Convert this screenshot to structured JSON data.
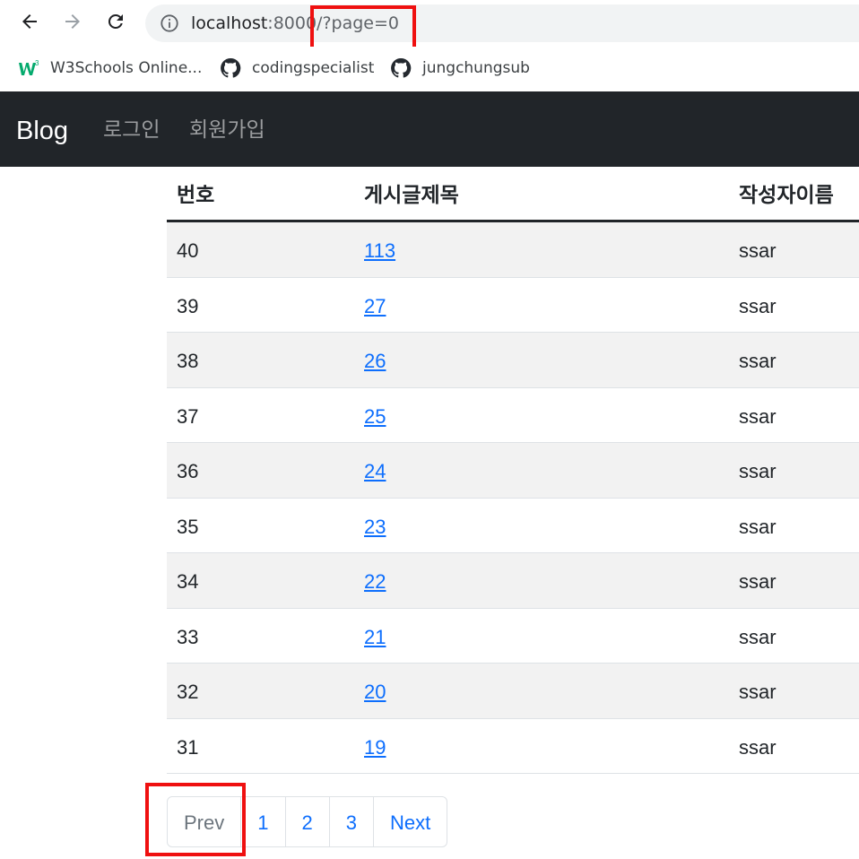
{
  "browser": {
    "url_host": "localhost",
    "url_rest": ":8000/?page=0",
    "bookmarks": [
      {
        "label": "W3Schools Online...",
        "icon": "w3schools-icon"
      },
      {
        "label": "codingspecialist",
        "icon": "github-icon"
      },
      {
        "label": "jungchungsub",
        "icon": "github-icon"
      }
    ]
  },
  "navbar": {
    "brand": "Blog",
    "links": [
      "로그인",
      "회원가입"
    ]
  },
  "table": {
    "headers": [
      "번호",
      "게시글제목",
      "작성자이름"
    ],
    "rows": [
      {
        "id": "40",
        "title": "113",
        "author": "ssar"
      },
      {
        "id": "39",
        "title": "27",
        "author": "ssar"
      },
      {
        "id": "38",
        "title": "26",
        "author": "ssar"
      },
      {
        "id": "37",
        "title": "25",
        "author": "ssar"
      },
      {
        "id": "36",
        "title": "24",
        "author": "ssar"
      },
      {
        "id": "35",
        "title": "23",
        "author": "ssar"
      },
      {
        "id": "34",
        "title": "22",
        "author": "ssar"
      },
      {
        "id": "33",
        "title": "21",
        "author": "ssar"
      },
      {
        "id": "32",
        "title": "20",
        "author": "ssar"
      },
      {
        "id": "31",
        "title": "19",
        "author": "ssar"
      }
    ]
  },
  "pagination": {
    "prev": "Prev",
    "pages": [
      "1",
      "2",
      "3"
    ],
    "next": "Next"
  },
  "colors": {
    "navbar_bg": "#212529",
    "link": "#0d6efd",
    "highlight": "#ef1010"
  }
}
